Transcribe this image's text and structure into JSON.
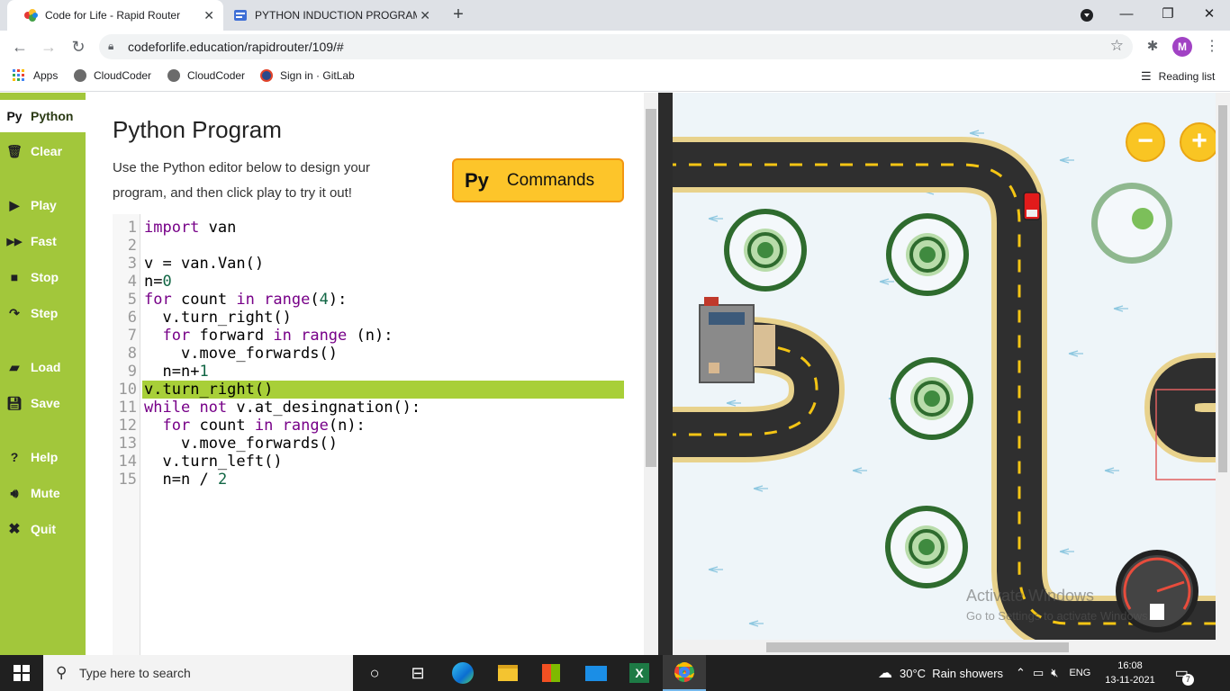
{
  "browser": {
    "tabs": [
      {
        "title": "Code for Life - Rapid Router",
        "active": true
      },
      {
        "title": "PYTHON INDUCTION PROGRAM",
        "active": false
      }
    ],
    "new_tab": "+",
    "window_controls": {
      "minimize": "—",
      "maximize": "❐",
      "close": "✕"
    },
    "url": "codeforlife.education/rapidrouter/109/#",
    "profile_initial": "M",
    "bookmarks": [
      {
        "label": "Apps"
      },
      {
        "label": "CloudCoder"
      },
      {
        "label": "CloudCoder"
      },
      {
        "label": "Sign in · GitLab"
      }
    ],
    "reading_list": "Reading list"
  },
  "sidebar": {
    "items": [
      {
        "label": "Python",
        "icon": "Py",
        "active": true
      },
      {
        "label": "Clear",
        "icon": "trash-icon"
      },
      {
        "label": "Play",
        "icon": "play-icon"
      },
      {
        "label": "Fast",
        "icon": "fast-forward-icon"
      },
      {
        "label": "Stop",
        "icon": "stop-icon"
      },
      {
        "label": "Step",
        "icon": "step-icon"
      },
      {
        "label": "Load",
        "icon": "folder-icon"
      },
      {
        "label": "Save",
        "icon": "save-icon"
      },
      {
        "label": "Help",
        "icon": "help-icon"
      },
      {
        "label": "Mute",
        "icon": "speaker-icon"
      },
      {
        "label": "Quit",
        "icon": "close-icon"
      }
    ]
  },
  "editor": {
    "title": "Python Program",
    "description": "Use the Python editor below to design your program, and then click play to try it out!",
    "commands_button": {
      "py": "Py",
      "label": "Commands"
    },
    "highlight_line": 10,
    "code_lines": [
      "import van",
      "",
      "v = van.Van()",
      "n=0",
      "for count in range(4):",
      "  v.turn_right()",
      "  for forward in range (n):",
      "    v.move_forwards()",
      "  n=n+1",
      "v.turn_right()",
      "while not v.at_desingnation():",
      "  for count in range(n):",
      "    v.move_forwards()",
      "  v.turn_left()",
      "  n=n / 2"
    ]
  },
  "game": {
    "zoom_out": "−",
    "zoom_in": "+",
    "watermark_line1": "Activate Windows",
    "watermark_line2": "Go to Settings to activate Windows."
  },
  "taskbar": {
    "search_placeholder": "Type here to search",
    "weather": "30°C  Rain showers",
    "language": "ENG",
    "time": "16:08",
    "date": "13-11-2021",
    "notifications": "7"
  }
}
